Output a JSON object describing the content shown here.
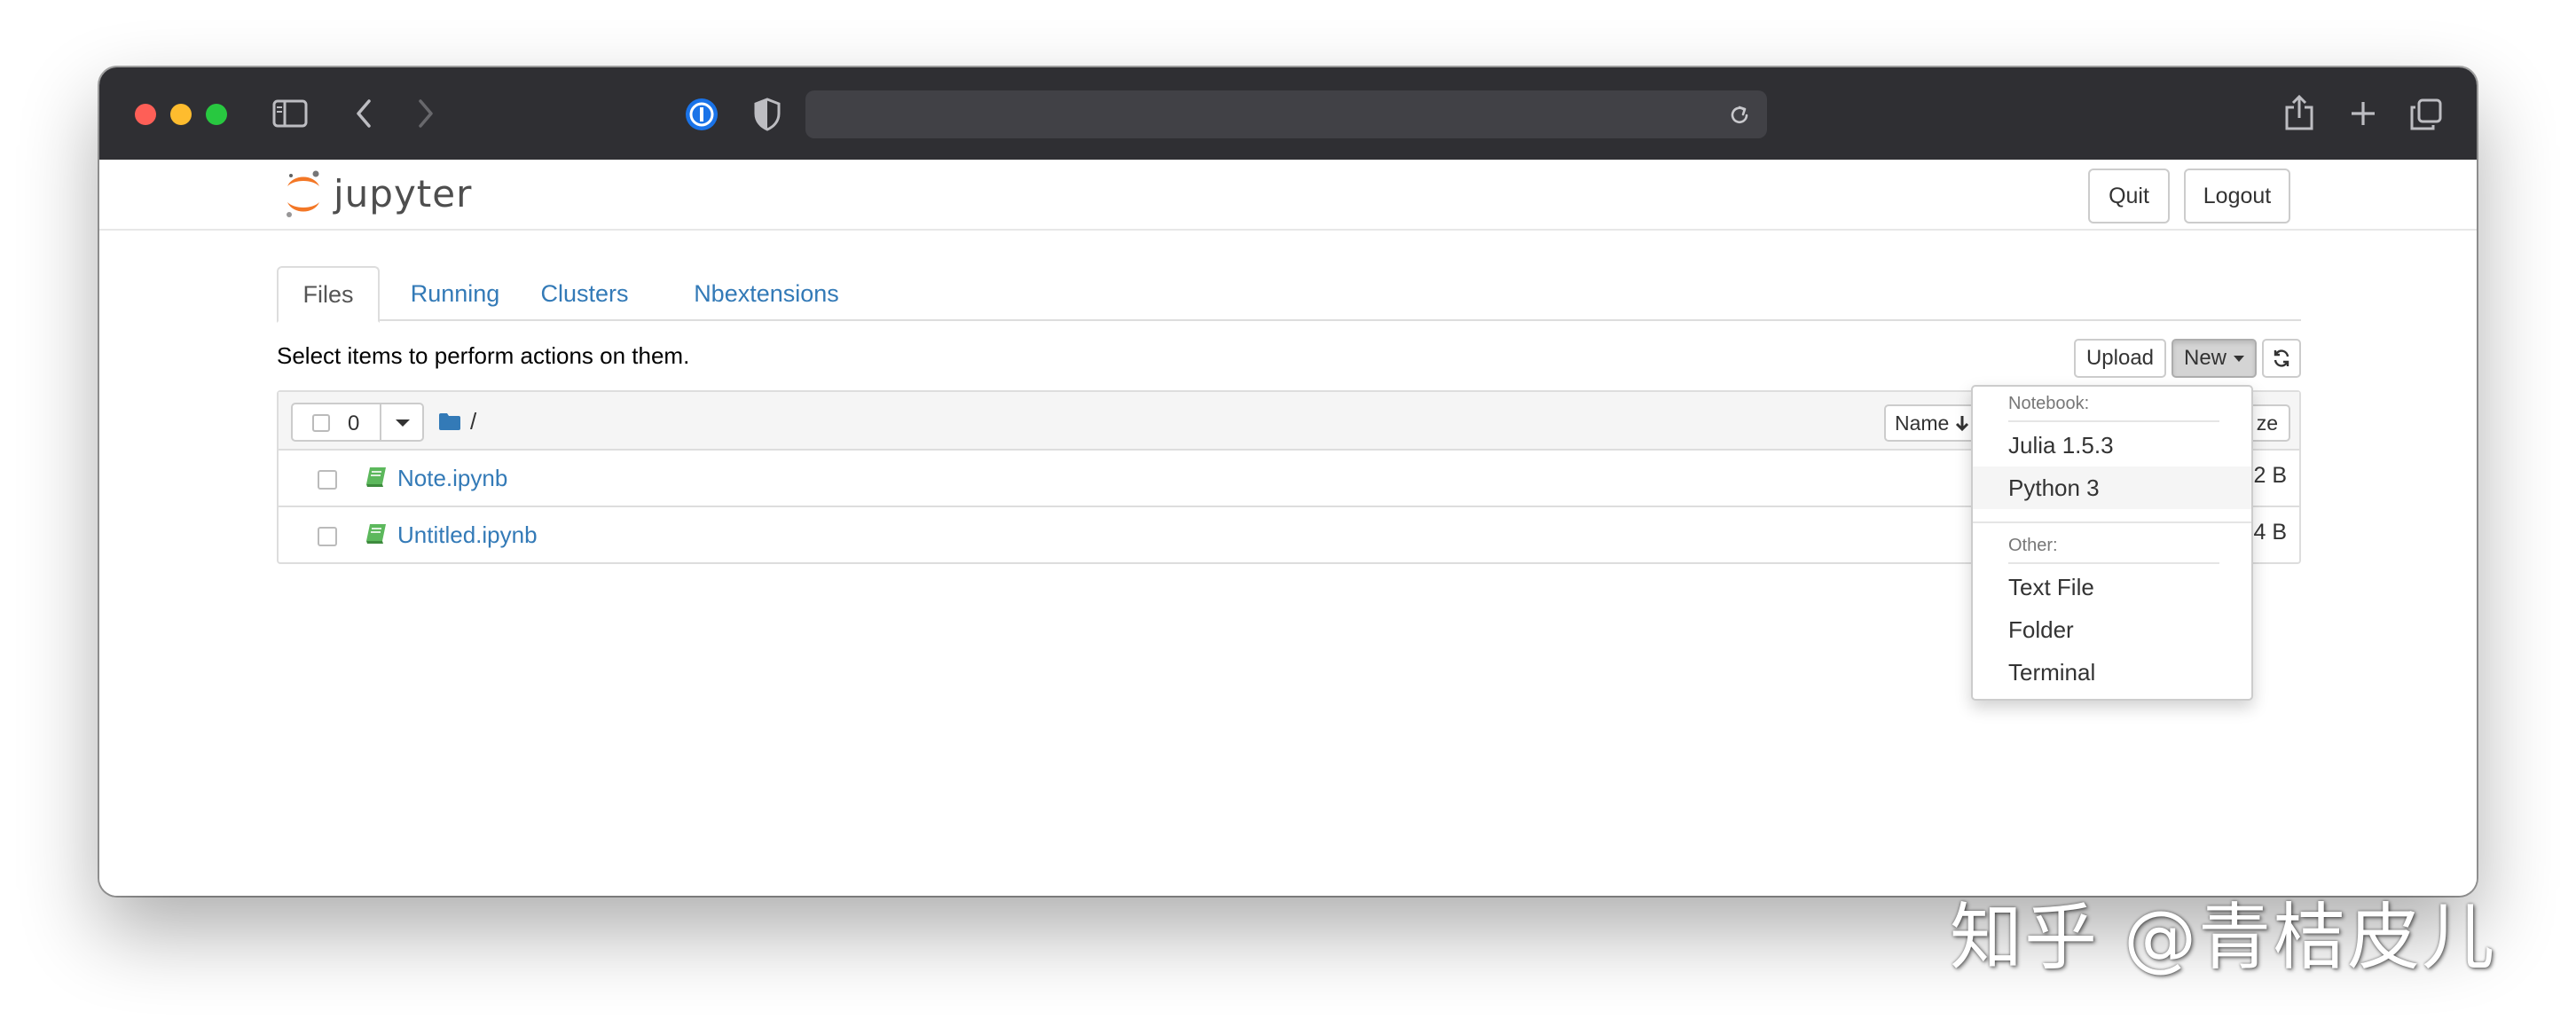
{
  "browser": {
    "icons": [
      "sidebar-icon",
      "back-icon",
      "forward-icon",
      "password-manager-icon",
      "privacy-shield-icon",
      "reload-icon",
      "share-icon",
      "new-tab-icon",
      "tabs-overview-icon"
    ],
    "address": ""
  },
  "jupyter": {
    "logo_text": "jupyter",
    "quit_label": "Quit",
    "logout_label": "Logout"
  },
  "tabs": [
    {
      "label": "Files",
      "active": true
    },
    {
      "label": "Running",
      "active": false
    },
    {
      "label": "Clusters",
      "active": false
    },
    {
      "label": "Nbextensions",
      "active": false
    }
  ],
  "toolbar": {
    "instructions": "Select items to perform actions on them.",
    "upload_label": "Upload",
    "new_label": "New"
  },
  "list": {
    "selected_count": "0",
    "breadcrumb": "/",
    "sort_label": "Name",
    "size_header": "ze",
    "files": [
      {
        "name": "Note.ipynb",
        "size": "2 B"
      },
      {
        "name": "Untitled.ipynb",
        "size": "4 B"
      }
    ]
  },
  "new_menu": {
    "notebook_header": "Notebook:",
    "notebook_items": [
      "Julia 1.5.3",
      "Python 3"
    ],
    "other_header": "Other:",
    "other_items": [
      "Text File",
      "Folder",
      "Terminal"
    ]
  },
  "watermark": "知乎 @青桔皮儿",
  "colors": {
    "link": "#337ab7",
    "titlebar": "#2f2f33",
    "logo_orange": "#f37726"
  }
}
